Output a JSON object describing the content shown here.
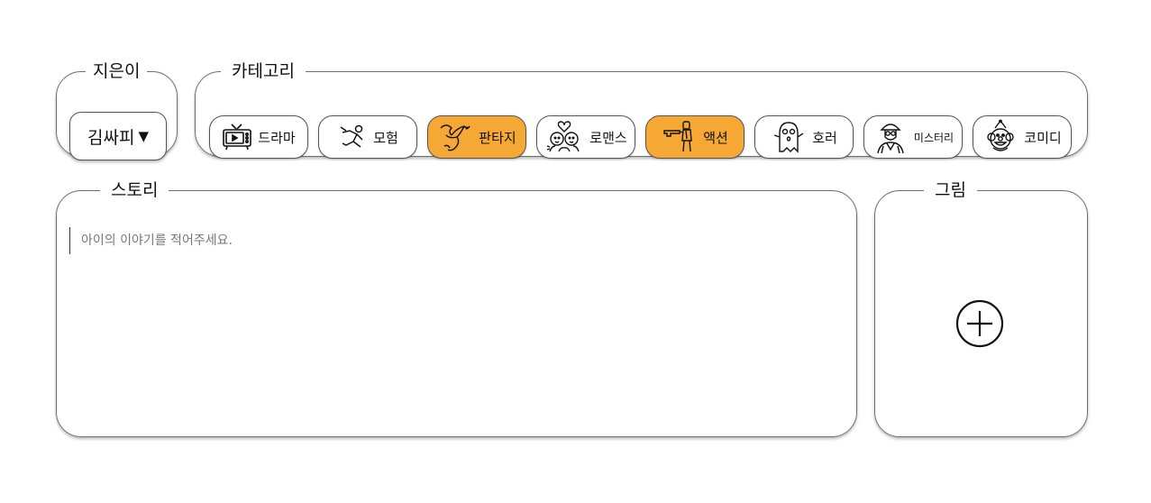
{
  "author": {
    "legend": "지은이",
    "selected": "김싸피",
    "arrow": "▼"
  },
  "category": {
    "legend": "카테고리",
    "items": [
      {
        "label": "드라마",
        "icon": "tv-icon",
        "selected": false
      },
      {
        "label": "모험",
        "icon": "running-figure-icon",
        "selected": false
      },
      {
        "label": "판타지",
        "icon": "dragon-icon",
        "selected": true
      },
      {
        "label": "로맨스",
        "icon": "couple-heart-icon",
        "selected": false
      },
      {
        "label": "액션",
        "icon": "gunman-icon",
        "selected": true
      },
      {
        "label": "호러",
        "icon": "ghost-icon",
        "selected": false
      },
      {
        "label": "미스터리",
        "icon": "detective-icon",
        "selected": false
      },
      {
        "label": "코미디",
        "icon": "clown-icon",
        "selected": false
      }
    ],
    "selected_color": "#f5a934"
  },
  "story": {
    "legend": "스토리",
    "placeholder": "아이의 이야기를 적어주세요."
  },
  "drawing": {
    "legend": "그림",
    "add_icon": "plus-circle-icon"
  }
}
